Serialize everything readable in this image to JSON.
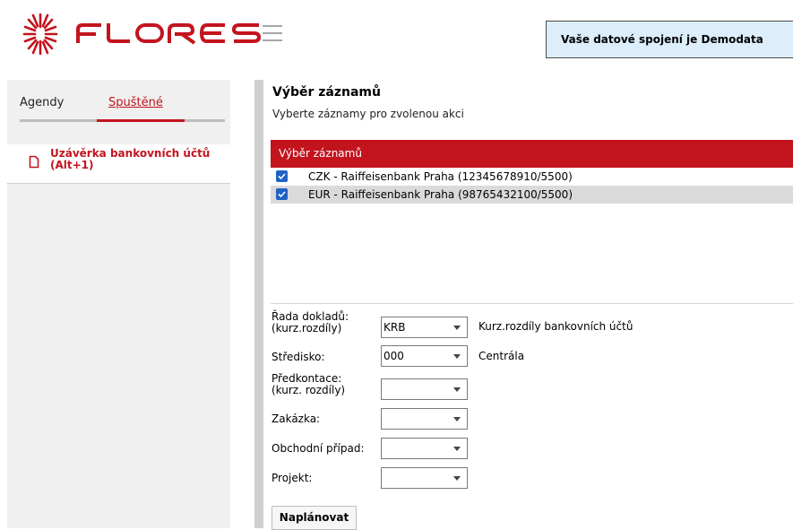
{
  "header": {
    "logo_text": "FLORES",
    "connection_text": "Vaše datové spojení je Demodata",
    "brand_color": "#c3141e"
  },
  "left": {
    "tabs": [
      {
        "label": "Agendy",
        "active": false
      },
      {
        "label": "Spuštěné",
        "active": true
      }
    ],
    "running_items": [
      {
        "label_line1": "Uzávěrka bankovních účtů",
        "label_line2": "(Alt+1)",
        "icon": "document-icon"
      }
    ]
  },
  "main": {
    "title": "Výběr záznamů",
    "subtitle": "Vyberte záznamy pro zvolenou akci",
    "list": {
      "header": "Výběr záznamů",
      "rows": [
        {
          "text": "CZK - Raiffeisenbank Praha (12345678910/5500)",
          "checked": true,
          "selected": false
        },
        {
          "text": "EUR - Raiffeisenbank Praha (98765432100/5500)",
          "checked": true,
          "selected": true
        }
      ]
    },
    "form": {
      "rada": {
        "label1": "Řada dokladů:",
        "label2": "(kurz.rozdíly)",
        "value": "KRB",
        "desc": "Kurz.rozdíly bankovních účtů"
      },
      "stredisko": {
        "label": "Středisko:",
        "value": "000",
        "desc": "Centrála"
      },
      "predkontace": {
        "label1": "Předkontace:",
        "label2": "(kurz. rozdíly)",
        "value": ""
      },
      "zakazka": {
        "label": "Zakázka:",
        "value": ""
      },
      "obchodni_pripad": {
        "label": "Obchodní případ:",
        "value": ""
      },
      "projekt": {
        "label": "Projekt:",
        "value": ""
      }
    },
    "plan_button": "Naplánovat"
  }
}
